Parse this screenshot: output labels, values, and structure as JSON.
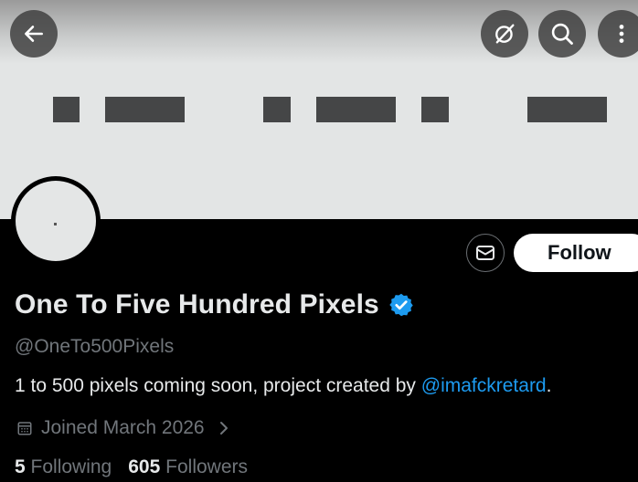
{
  "header": {
    "back_icon": "arrow-left-icon",
    "actions": [
      {
        "icon": "grok-icon"
      },
      {
        "icon": "search-icon"
      },
      {
        "icon": "more-vertical-icon"
      }
    ]
  },
  "banner": {
    "background": "#e3e5e5",
    "block_color": "#454647"
  },
  "profile": {
    "follow_label": "Follow",
    "display_name": "One To Five Hundred Pixels",
    "verified": true,
    "handle": "@OneTo500Pixels",
    "bio_text": "1 to 500 pixels coming soon, project created by ",
    "bio_mention": "@imafckretard",
    "bio_end": ".",
    "joined": "Joined March 2026",
    "following_count": "5",
    "following_label": "Following",
    "followers_count": "605",
    "followers_label": "Followers"
  },
  "colors": {
    "accent": "#1d9bf0",
    "text_primary": "#e7e9ea",
    "text_secondary": "#71767b",
    "background": "#000000"
  }
}
